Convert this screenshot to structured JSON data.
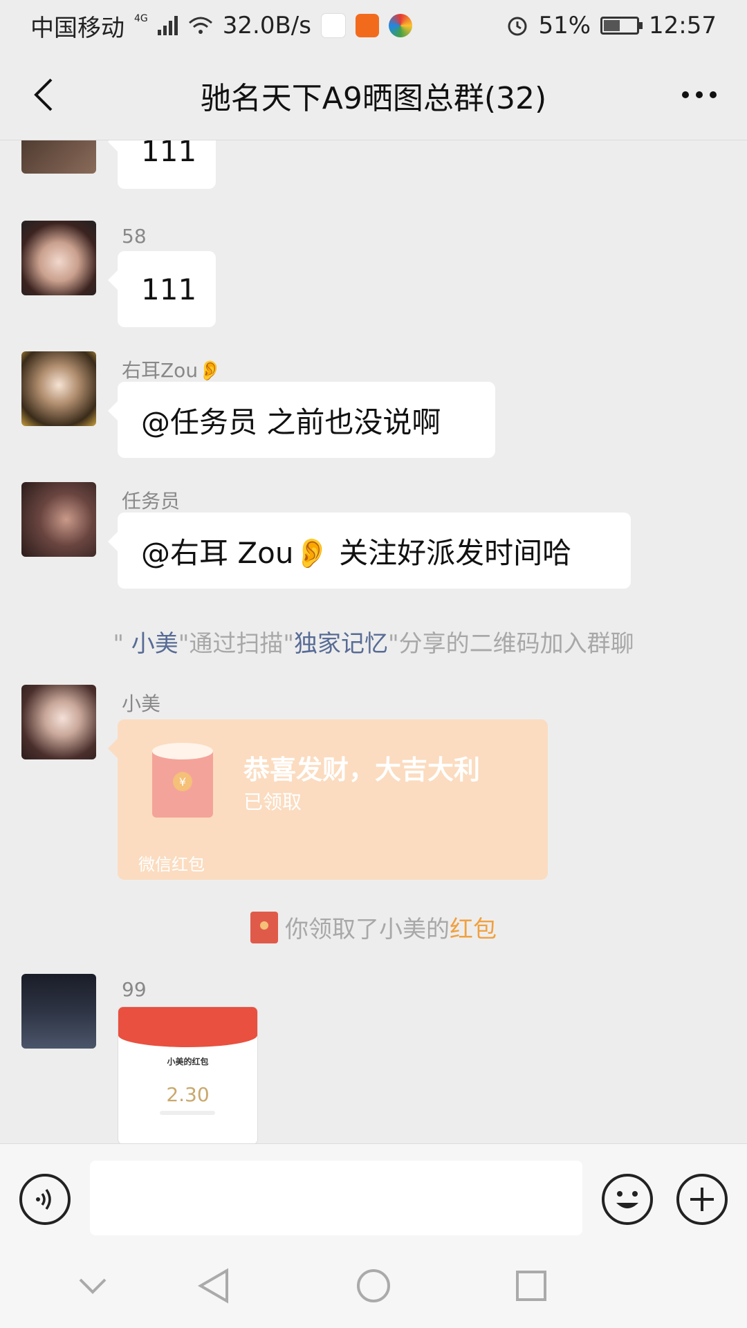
{
  "status_bar": {
    "carrier": "中国移动",
    "network": "4G",
    "speed": "32.0B/s",
    "battery": "51%",
    "time": "12:57",
    "battery_level": 0.51
  },
  "header": {
    "title": "驰名天下A9晒图总群(32)"
  },
  "messages": [
    {
      "sender": "",
      "text": "111"
    },
    {
      "sender": "58",
      "text": "111"
    },
    {
      "sender": "右耳Zou👂",
      "text": "@任务员  之前也没说啊"
    },
    {
      "sender": "任务员",
      "text": "@右耳 Zou👂  关注好派发时间哈"
    }
  ],
  "system_join": {
    "q1": "\" ",
    "user": "小美",
    "mid": "\"通过扫描\"",
    "sharer": "独家记忆",
    "end": "\"分享的二维码加入群聊"
  },
  "red_packet_msg": {
    "sender": "小美",
    "title": "恭喜发财，大吉大利",
    "status": "已领取",
    "footer": "微信红包"
  },
  "system_redpack": {
    "text": "你领取了小美的",
    "link": "红包"
  },
  "image_msg": {
    "sender": "99",
    "thumb_title": "小美的红包",
    "thumb_amount": "2.30"
  },
  "input_bar": {
    "placeholder": ""
  },
  "colors": {
    "background": "#ededed",
    "link": "#576b95",
    "red_packet": "#fbdcc0",
    "red_link": "#f0a040"
  }
}
